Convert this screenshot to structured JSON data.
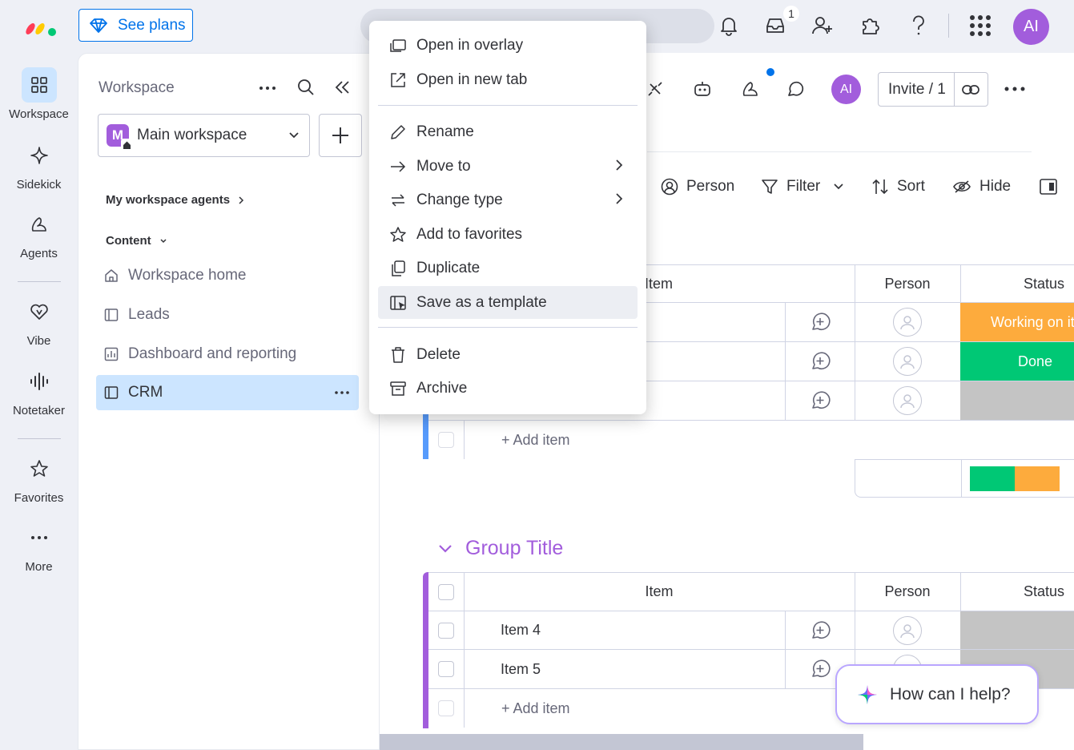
{
  "topbar": {
    "see_plans": "See plans",
    "inbox_count": "1",
    "avatar": "AI"
  },
  "rail": {
    "items": [
      {
        "label": "Workspace",
        "icon": "grid-icon"
      },
      {
        "label": "Sidekick",
        "icon": "sparkle-icon"
      },
      {
        "label": "Agents",
        "icon": "agents-icon"
      },
      {
        "label": "Vibe",
        "icon": "heart-icon"
      },
      {
        "label": "Notetaker",
        "icon": "waveform-icon"
      },
      {
        "label": "Favorites",
        "icon": "star-icon"
      },
      {
        "label": "More",
        "icon": "more-dots-icon"
      }
    ]
  },
  "workspace": {
    "title": "Workspace",
    "selector": "Main workspace",
    "selector_badge": "M",
    "agents_section": "My workspace agents",
    "content_section": "Content",
    "items": [
      {
        "label": "Workspace home",
        "icon": "home-icon"
      },
      {
        "label": "Leads",
        "icon": "board-icon"
      },
      {
        "label": "Dashboard and reporting",
        "icon": "dashboard-icon"
      },
      {
        "label": "CRM",
        "icon": "board-icon"
      }
    ]
  },
  "board": {
    "avatar": "AI",
    "invite": "Invite / 1",
    "toolbar": {
      "person": "Person",
      "filter": "Filter",
      "sort": "Sort",
      "hide": "Hide"
    },
    "columns": {
      "item": "Item",
      "person": "Person",
      "status": "Status"
    },
    "group1": {
      "statuses": [
        "Working on it",
        "Done",
        ""
      ],
      "add_item": "+ Add item"
    },
    "group2": {
      "title": "Group Title",
      "rows": [
        "Item 4",
        "Item 5"
      ],
      "add_item": "+ Add item"
    },
    "status_summary": [
      {
        "label": "Done",
        "share": 0.5
      },
      {
        "label": "Working on it",
        "share": 0.5
      }
    ]
  },
  "colors": {
    "primary": "#0073ea",
    "working": "#fdab3d",
    "done": "#00c875",
    "empty_status": "#c4c4c4",
    "group2": "#a25ddc",
    "group1": "#579bfc"
  },
  "context_menu": {
    "items": [
      {
        "label": "Open in overlay",
        "icon": "overlay-icon"
      },
      {
        "label": "Open in new tab",
        "icon": "external-link-icon"
      },
      {
        "label": "Rename",
        "icon": "pencil-icon"
      },
      {
        "label": "Move to",
        "icon": "arrow-right-icon"
      },
      {
        "label": "Change type",
        "icon": "swap-icon"
      },
      {
        "label": "Add to favorites",
        "icon": "star-icon"
      },
      {
        "label": "Duplicate",
        "icon": "duplicate-icon"
      },
      {
        "label": "Save as a template",
        "icon": "template-icon"
      },
      {
        "label": "Delete",
        "icon": "trash-icon"
      },
      {
        "label": "Archive",
        "icon": "archive-icon"
      }
    ]
  },
  "help": {
    "text": "How can I help?"
  }
}
